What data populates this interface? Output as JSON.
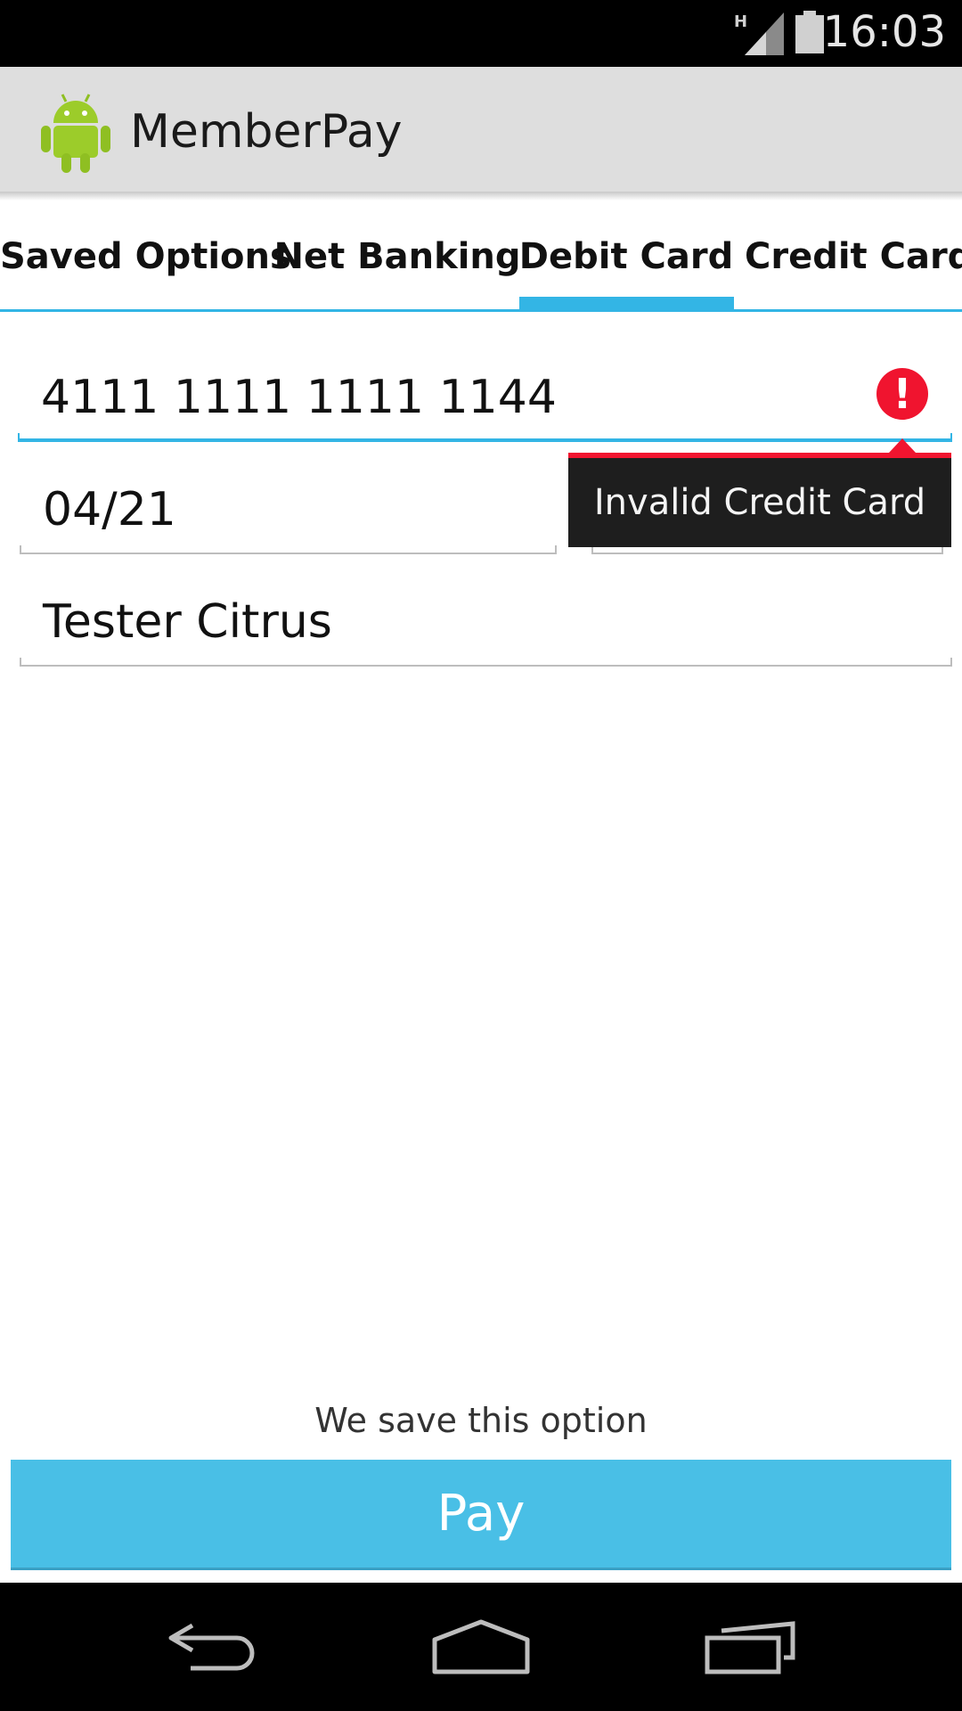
{
  "status_bar": {
    "time": "16:03",
    "network_type": "H",
    "icons": [
      "signal-icon",
      "battery-icon"
    ]
  },
  "app_bar": {
    "title": "MemberPay",
    "icon": "android-logo-icon"
  },
  "tabs": [
    {
      "label": "Saved Options",
      "selected": false
    },
    {
      "label": "Net Banking",
      "selected": false
    },
    {
      "label": "Debit Card",
      "selected": true
    },
    {
      "label": "Credit Card",
      "selected": false
    }
  ],
  "form": {
    "card_number": "4111 1111 1111 1144",
    "expiry": "04/21",
    "cvv_obscured": "",
    "name": "Tester Citrus",
    "error_message": "Invalid Credit Card",
    "error_icon_glyph": "!"
  },
  "footer": {
    "save_note": "We save this option",
    "pay_label": "Pay"
  },
  "colors": {
    "accent": "#33b5e5",
    "pay_button": "#49bfe6",
    "error": "#f0142f"
  },
  "nav_bar": {
    "icons": [
      "back-icon",
      "home-icon",
      "recents-icon"
    ]
  }
}
